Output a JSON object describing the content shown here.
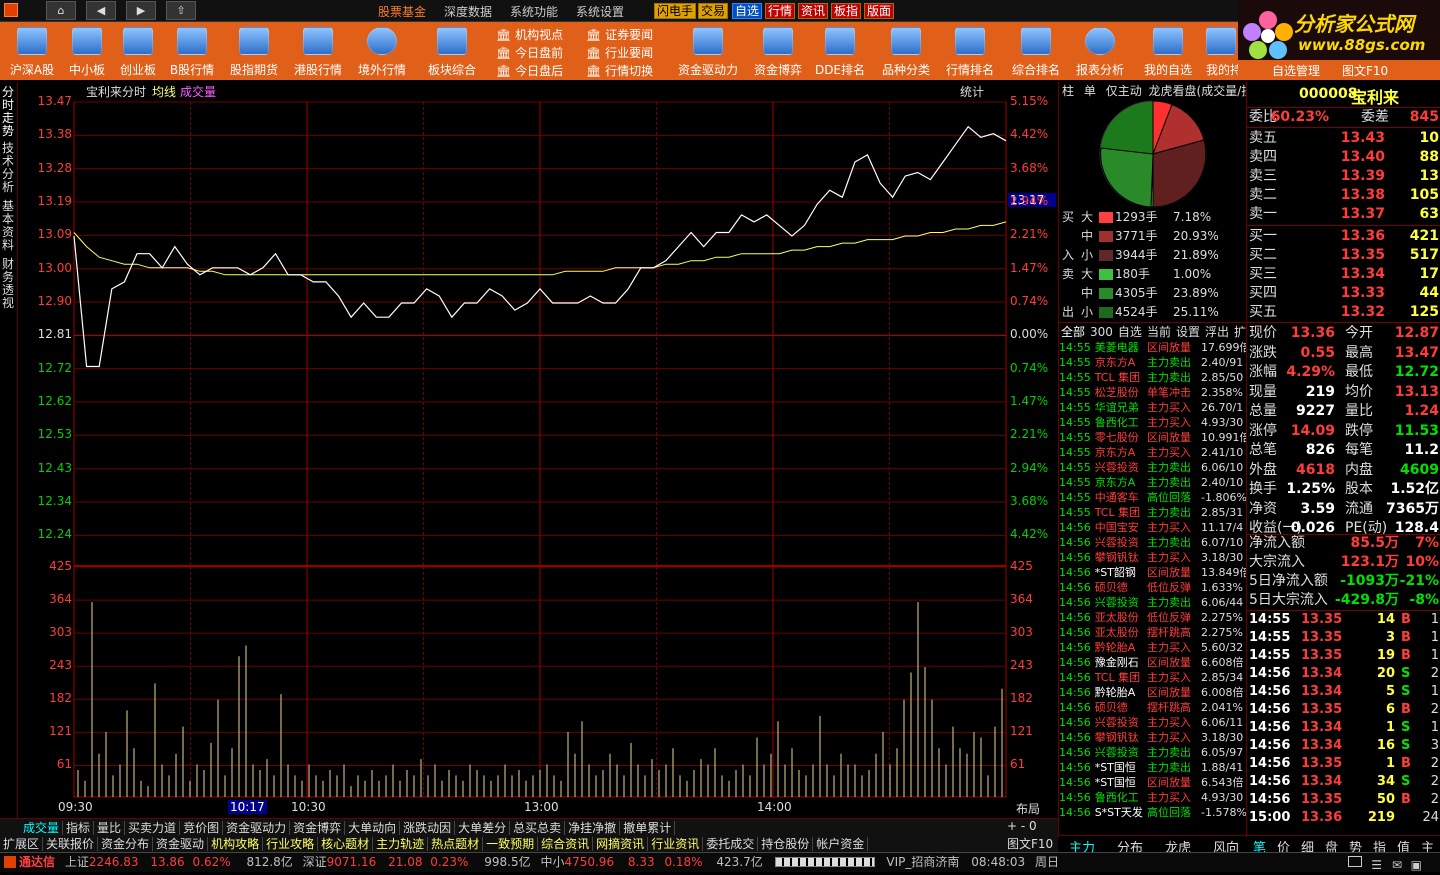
{
  "top_menu": {
    "items": [
      "股票基金",
      "深度数据",
      "系统功能",
      "系统设置"
    ],
    "quick": [
      "闪电手",
      "交易",
      "自选",
      "行情",
      "资讯",
      "板指",
      "版面"
    ]
  },
  "logo": {
    "title": "分析家公式网",
    "url": "www.88gs.com"
  },
  "toolbar": {
    "items": [
      "沪深A股",
      "中小板",
      "创业板",
      "B股行情",
      "股指期货",
      "港股行情",
      "境外行情",
      "板块综合",
      "资金驱动力",
      "资金博弈",
      "DDE排名",
      "品种分类",
      "行情排名",
      "综合排名",
      "报表分析",
      "我的自选",
      "我的持仓",
      "自选管理",
      "图文F10"
    ],
    "small": [
      "机构视点",
      "今日盘前",
      "今日盘后",
      "证券要闻",
      "行业要闻",
      "行情切换"
    ]
  },
  "leftnav": [
    "分时走势",
    "技术分析",
    "基本资料",
    "财务透视"
  ],
  "chart": {
    "name": "宝利来",
    "mode": "分时",
    "avg": "均线",
    "vol": "成交量",
    "stat": "统计",
    "cursor": "13.17",
    "time_tip": "10:17",
    "layout_btn": "布局",
    "zoom": "+ - 0",
    "price_labels": [
      "13.47",
      "13.38",
      "13.28",
      "13.19",
      "13.09",
      "13.00",
      "12.90",
      "12.81",
      "12.72",
      "12.62",
      "12.53",
      "12.43",
      "12.34",
      "12.24"
    ],
    "pct_labels": [
      "5.15%",
      "4.42%",
      "3.68%",
      "2.94%",
      "2.21%",
      "1.47%",
      "0.74%",
      "0.00%",
      "0.74%",
      "1.47%",
      "2.21%",
      "2.94%",
      "3.68%",
      "4.42%"
    ],
    "vol_labels": [
      "425",
      "364",
      "303",
      "243",
      "182",
      "121",
      "61"
    ],
    "time_labels": [
      "09:30",
      "10:30",
      "13:00",
      "14:00"
    ]
  },
  "chart_data": {
    "type": "line",
    "title": "宝利来",
    "series": [
      {
        "name": "分时",
        "values": [
          13.09,
          12.72,
          12.72,
          12.94,
          12.96,
          13.04,
          13.04,
          13.0,
          13.06,
          13.01,
          12.98,
          13.0,
          13.0,
          13.0,
          12.98,
          13.0,
          13.04,
          12.98,
          12.98,
          12.96,
          12.96,
          12.92,
          12.86,
          12.9,
          12.86,
          12.86,
          12.9,
          12.9,
          12.94,
          12.92,
          12.86,
          12.9,
          12.9,
          12.94,
          12.92,
          12.88,
          12.9,
          12.94,
          12.9,
          12.9,
          12.9,
          12.92,
          12.9,
          12.9,
          12.94,
          13.0,
          13.0,
          13.02,
          13.06,
          13.1,
          13.06,
          13.1,
          13.1,
          13.15,
          13.13,
          13.15,
          13.12,
          13.09,
          13.12,
          13.18,
          13.22,
          13.2,
          13.3,
          13.32,
          13.24,
          13.2,
          13.26,
          13.27,
          13.25,
          13.3,
          13.35,
          13.4,
          13.37,
          13.38,
          13.36
        ]
      },
      {
        "name": "均线",
        "values": [
          13.1,
          13.06,
          13.03,
          13.02,
          13.01,
          13.01,
          13.0,
          13.0,
          13.0,
          13.0,
          12.99,
          12.99,
          12.98,
          12.98,
          12.98,
          12.98,
          12.98,
          12.98,
          12.98,
          12.98,
          12.98,
          12.98,
          12.98,
          12.98,
          12.98,
          12.98,
          12.98,
          12.98,
          12.98,
          12.98,
          12.98,
          12.98,
          12.98,
          12.98,
          12.98,
          12.98,
          12.98,
          12.98,
          12.98,
          12.99,
          12.99,
          12.99,
          12.99,
          13.0,
          13.0,
          13.0,
          13.0,
          13.01,
          13.01,
          13.02,
          13.02,
          13.03,
          13.03,
          13.04,
          13.04,
          13.04,
          13.04,
          13.05,
          13.05,
          13.06,
          13.06,
          13.07,
          13.07,
          13.08,
          13.08,
          13.08,
          13.09,
          13.09,
          13.1,
          13.1,
          13.11,
          13.11,
          13.12,
          13.12,
          13.13
        ]
      }
    ],
    "volume": [
      50,
      30,
      360,
      80,
      120,
      40,
      60,
      160,
      90,
      30,
      20,
      210,
      60,
      40,
      80,
      130,
      30,
      60,
      50,
      100,
      180,
      40,
      90,
      260,
      280,
      60,
      50,
      70,
      40,
      190,
      60,
      40,
      30,
      60,
      40,
      30,
      50,
      40,
      60,
      20,
      40,
      30,
      50,
      30,
      40,
      60,
      30,
      50,
      40,
      70,
      40,
      60,
      30,
      50,
      40,
      30,
      60,
      50,
      40,
      30,
      40,
      60,
      40,
      50,
      30,
      40,
      50,
      60,
      40,
      30,
      120,
      80,
      140,
      60,
      40,
      50,
      80,
      60,
      40,
      100,
      60,
      40,
      70,
      50,
      60,
      90,
      40,
      30,
      50,
      70,
      60,
      90,
      40,
      30,
      50,
      60,
      40,
      110,
      60,
      80,
      140,
      60,
      90,
      50,
      40,
      60,
      150,
      60,
      40,
      80,
      60,
      60,
      40,
      50,
      80,
      120,
      60,
      90,
      180,
      230,
      360,
      240,
      180,
      90,
      60,
      130,
      90,
      80,
      120,
      110,
      40,
      130,
      200
    ],
    "ylim": [
      12.15,
      13.47
    ],
    "vol_max": 425
  },
  "pie": {
    "tabs": [
      "柱",
      "单",
      "仅主动",
      "龙虎看盘(成交量/技能"
    ],
    "buy": [
      {
        "l": "大",
        "v": "1293手",
        "p": "7.18%"
      },
      {
        "l": "中",
        "v": "3771手",
        "p": "20.93%"
      },
      {
        "l": "小",
        "v": "3944手",
        "p": "21.89%"
      }
    ],
    "sell": [
      {
        "l": "大",
        "v": "180手",
        "p": "1.00%"
      },
      {
        "l": "中",
        "v": "4305手",
        "p": "23.89%"
      },
      {
        "l": "小",
        "v": "4524手",
        "p": "25.11%"
      }
    ],
    "buy_label": [
      "买",
      "入"
    ],
    "sell_label": [
      "卖",
      "出"
    ]
  },
  "news_tabs": [
    "全部",
    "300",
    "自选",
    "当前",
    "设置",
    "浮出",
    "扩大"
  ],
  "news": [
    {
      "t": "14:55",
      "n": "美菱电器",
      "a": "区间放量",
      "d": "17.699倍",
      "c": "green"
    },
    {
      "t": "14:55",
      "n": "京东方A",
      "a": "主力卖出",
      "d": "2.40/91",
      "c": "red"
    },
    {
      "t": "14:55",
      "n": "TCL 集团",
      "a": "主力卖出",
      "d": "2.85/50",
      "c": "red"
    },
    {
      "t": "14:55",
      "n": "松芝股份",
      "a": "单笔冲击",
      "d": "2.358%",
      "c": "red"
    },
    {
      "t": "14:55",
      "n": "华谊兄弟",
      "a": "主力买入",
      "d": "26.70/1",
      "c": "green"
    },
    {
      "t": "14:55",
      "n": "鲁西化工",
      "a": "主力买入",
      "d": "4.93/30",
      "c": "green"
    },
    {
      "t": "14:55",
      "n": "零七股份",
      "a": "区间放量",
      "d": "10.991倍",
      "c": "red"
    },
    {
      "t": "14:55",
      "n": "京东方A",
      "a": "主力买入",
      "d": "2.41/10",
      "c": "red"
    },
    {
      "t": "14:55",
      "n": "兴蓉投资",
      "a": "主力卖出",
      "d": "6.06/10",
      "c": "red"
    },
    {
      "t": "14:55",
      "n": "京东方A",
      "a": "主力卖出",
      "d": "2.40/10",
      "c": "green"
    },
    {
      "t": "14:55",
      "n": "中通客车",
      "a": "高位回落",
      "d": "-1.806%",
      "c": "red"
    },
    {
      "t": "14:55",
      "n": "TCL 集团",
      "a": "主力卖出",
      "d": "2.85/31",
      "c": "red"
    },
    {
      "t": "14:56",
      "n": "中国宝安",
      "a": "主力买入",
      "d": "11.17/4",
      "c": "red"
    },
    {
      "t": "14:56",
      "n": "兴蓉投资",
      "a": "主力卖出",
      "d": "6.07/10",
      "c": "red"
    },
    {
      "t": "14:56",
      "n": "攀钢钒钛",
      "a": "主力买入",
      "d": "3.18/30",
      "c": "red"
    },
    {
      "t": "14:56",
      "n": "*ST韶钢",
      "a": "区间放量",
      "d": "13.849倍",
      "c": "white"
    },
    {
      "t": "14:56",
      "n": "硕贝德",
      "a": "低位反弹",
      "d": "1.633%",
      "c": "red"
    },
    {
      "t": "14:56",
      "n": "兴蓉投资",
      "a": "主力卖出",
      "d": "6.06/44",
      "c": "green"
    },
    {
      "t": "14:56",
      "n": "亚太股份",
      "a": "低位反弹",
      "d": "2.275%",
      "c": "red"
    },
    {
      "t": "14:56",
      "n": "亚太股份",
      "a": "摆杆跳高",
      "d": "2.275%",
      "c": "red"
    },
    {
      "t": "14:56",
      "n": "黔轮胎A",
      "a": "主力买入",
      "d": "5.60/32",
      "c": "red"
    },
    {
      "t": "14:56",
      "n": "豫金刚石",
      "a": "区间放量",
      "d": "6.608倍",
      "c": "white"
    },
    {
      "t": "14:56",
      "n": "TCL 集团",
      "a": "主力买入",
      "d": "2.85/34",
      "c": "red"
    },
    {
      "t": "14:56",
      "n": "黔轮胎A",
      "a": "区间放量",
      "d": "6.008倍",
      "c": "white"
    },
    {
      "t": "14:56",
      "n": "硕贝德",
      "a": "摆杆跳高",
      "d": "2.041%",
      "c": "red"
    },
    {
      "t": "14:56",
      "n": "兴蓉投资",
      "a": "主力买入",
      "d": "6.06/11",
      "c": "red"
    },
    {
      "t": "14:56",
      "n": "攀钢钒钛",
      "a": "主力买入",
      "d": "3.18/30",
      "c": "red"
    },
    {
      "t": "14:56",
      "n": "兴蓉投资",
      "a": "主力卖出",
      "d": "6.05/97",
      "c": "green"
    },
    {
      "t": "14:56",
      "n": "*ST国恒",
      "a": "主力卖出",
      "d": "1.88/41",
      "c": "white"
    },
    {
      "t": "14:56",
      "n": "*ST国恒",
      "a": "区间放量",
      "d": "6.543倍",
      "c": "white"
    },
    {
      "t": "14:56",
      "n": "鲁西化工",
      "a": "主力买入",
      "d": "4.93/30",
      "c": "green"
    },
    {
      "t": "14:56",
      "n": "S*ST天发",
      "a": "高位回落",
      "d": "-1.578%",
      "c": "white"
    }
  ],
  "right_tabs": [
    "主力",
    "分布",
    "龙虎",
    "风向"
  ],
  "quote": {
    "code": "000008",
    "name": "宝利来",
    "webi_l": "委比",
    "webi": "60.23%",
    "wecha_l": "委差",
    "wecha": "845",
    "sells": [
      {
        "l": "卖五",
        "p": "13.43",
        "v": "10"
      },
      {
        "l": "卖四",
        "p": "13.40",
        "v": "88"
      },
      {
        "l": "卖三",
        "p": "13.39",
        "v": "13"
      },
      {
        "l": "卖二",
        "p": "13.38",
        "v": "105"
      },
      {
        "l": "卖一",
        "p": "13.37",
        "v": "63"
      }
    ],
    "buys": [
      {
        "l": "买一",
        "p": "13.36",
        "v": "421"
      },
      {
        "l": "买二",
        "p": "13.35",
        "v": "517"
      },
      {
        "l": "买三",
        "p": "13.34",
        "v": "17"
      },
      {
        "l": "买四",
        "p": "13.33",
        "v": "44"
      },
      {
        "l": "买五",
        "p": "13.32",
        "v": "125"
      }
    ],
    "info": [
      {
        "l": "现价",
        "v": "13.36",
        "vc": "red",
        "l2": "今开",
        "v2": "12.87",
        "v2c": "red"
      },
      {
        "l": "涨跌",
        "v": "0.55",
        "vc": "red",
        "l2": "最高",
        "v2": "13.47",
        "v2c": "red"
      },
      {
        "l": "涨幅",
        "v": "4.29%",
        "vc": "red",
        "l2": "最低",
        "v2": "12.72",
        "v2c": "green"
      },
      {
        "l": "现量",
        "v": "219",
        "vc": "white",
        "l2": "均价",
        "v2": "13.13",
        "v2c": "red"
      },
      {
        "l": "总量",
        "v": "9227",
        "vc": "white",
        "l2": "量比",
        "v2": "1.24",
        "v2c": "red"
      },
      {
        "l": "涨停",
        "v": "14.09",
        "vc": "red",
        "l2": "跌停",
        "v2": "11.53",
        "v2c": "green"
      },
      {
        "l": "总笔",
        "v": "826",
        "vc": "white",
        "l2": "每笔",
        "v2": "11.2",
        "v2c": "white"
      },
      {
        "l": "外盘",
        "v": "4618",
        "vc": "red",
        "l2": "内盘",
        "v2": "4609",
        "v2c": "green"
      },
      {
        "l": "换手",
        "v": "1.25%",
        "vc": "white",
        "l2": "股本",
        "v2": "1.52亿",
        "v2c": "white"
      },
      {
        "l": "净资",
        "v": "3.59",
        "vc": "white",
        "l2": "流通",
        "v2": "7365万",
        "v2c": "white"
      },
      {
        "l": "收益(一)",
        "v": "0.026",
        "vc": "white",
        "l2": "PE(动)",
        "v2": "128.4",
        "v2c": "white"
      }
    ],
    "flows": [
      {
        "l": "净流入额",
        "v": "85.5万",
        "p": "7%",
        "c": "red"
      },
      {
        "l": "大宗流入",
        "v": "123.1万",
        "p": "10%",
        "c": "red"
      },
      {
        "l": "5日净流入额",
        "v": "-1093万",
        "p": "-21%",
        "c": "green"
      },
      {
        "l": "5日大宗流入",
        "v": "-429.8万",
        "p": "-8%",
        "c": "green"
      }
    ],
    "ticks": [
      {
        "t": "14:55",
        "p": "13.35",
        "v": "14",
        "d": "B",
        "n": "1"
      },
      {
        "t": "14:55",
        "p": "13.35",
        "v": "3",
        "d": "B",
        "n": "1"
      },
      {
        "t": "14:55",
        "p": "13.35",
        "v": "19",
        "d": "B",
        "n": "1"
      },
      {
        "t": "14:56",
        "p": "13.34",
        "v": "20",
        "d": "S",
        "n": "2"
      },
      {
        "t": "14:56",
        "p": "13.34",
        "v": "5",
        "d": "S",
        "n": "1"
      },
      {
        "t": "14:56",
        "p": "13.35",
        "v": "6",
        "d": "B",
        "n": "2"
      },
      {
        "t": "14:56",
        "p": "13.34",
        "v": "1",
        "d": "S",
        "n": "1"
      },
      {
        "t": "14:56",
        "p": "13.34",
        "v": "16",
        "d": "S",
        "n": "3"
      },
      {
        "t": "14:56",
        "p": "13.35",
        "v": "1",
        "d": "B",
        "n": "2"
      },
      {
        "t": "14:56",
        "p": "13.34",
        "v": "34",
        "d": "S",
        "n": "2"
      },
      {
        "t": "14:56",
        "p": "13.35",
        "v": "50",
        "d": "B",
        "n": "2"
      },
      {
        "t": "15:00",
        "p": "13.36",
        "v": "219",
        "d": "",
        "n": "24"
      }
    ],
    "bottom_tabs": [
      "笔",
      "价",
      "细",
      "盘",
      "势",
      "指",
      "值",
      "主"
    ]
  },
  "bottom1": [
    "成交量",
    "指标",
    "量比",
    "买卖力道",
    "竞价图",
    "资金驱动力",
    "资金博弈",
    "大单动向",
    "涨跌动因",
    "大单差分",
    "总买总卖",
    "净挂净撤",
    "撤单累计"
  ],
  "bottom2": [
    "扩展区",
    "关联报价",
    "资金分布",
    "资金驱动",
    "机构攻略",
    "行业攻略",
    "核心题材",
    "主力轨迹",
    "热点题材",
    "一致预期",
    "综合资讯",
    "网摘资讯",
    "行业资讯",
    "委托成交",
    "持仓股份",
    "帐户资金"
  ],
  "bottom2_right": "图文F10",
  "status": {
    "app": "通达信",
    "sh_l": "上证",
    "sh": "2246.83",
    "sh_c": "13.86",
    "sh_p": "0.62%",
    "sh_a": "812.8亿",
    "sz_l": "深证",
    "sz": "9071.16",
    "sz_c": "21.08",
    "sz_p": "0.23%",
    "sz_a": "998.5亿",
    "zx_l": "中小",
    "zx": "4750.96",
    "zx_c": "8.33",
    "zx_p": "0.18%",
    "zx_a": "423.7亿",
    "vip": "VIP_招商济南",
    "time": "08:48:03",
    "day": "周日"
  }
}
